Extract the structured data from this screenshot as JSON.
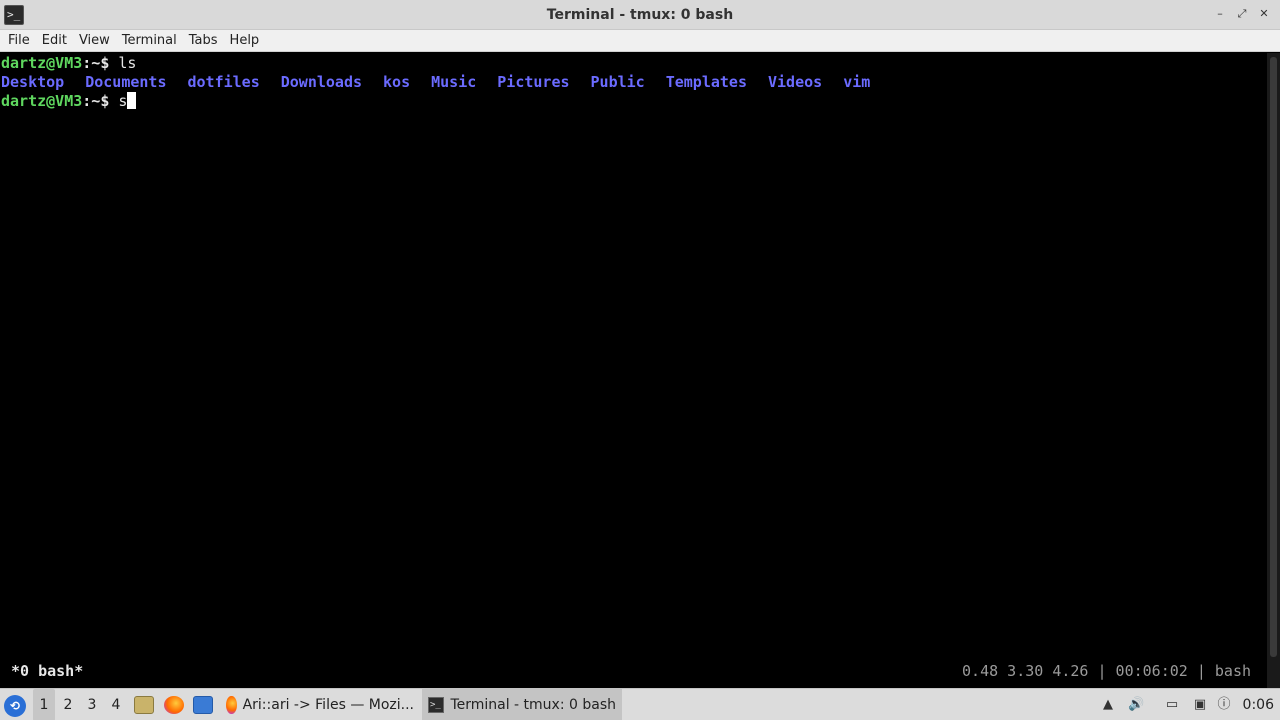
{
  "window": {
    "title": "Terminal - tmux: 0 bash",
    "app_icon_glyph": ">_",
    "buttons": {
      "minimize": "–",
      "maximize": "⤢",
      "close": "✕"
    }
  },
  "menubar": {
    "items": [
      "File",
      "Edit",
      "View",
      "Terminal",
      "Tabs",
      "Help"
    ]
  },
  "terminal": {
    "lines": [
      {
        "user": "dartz@VM3",
        "sep": ":~$",
        "command": "ls"
      },
      {
        "dirs": [
          "Desktop",
          "Documents",
          "dotfiles",
          "Downloads",
          "kos",
          "Music",
          "Pictures",
          "Public",
          "Templates",
          "Videos",
          "vim"
        ]
      },
      {
        "user": "dartz@VM3",
        "sep": ":~$",
        "command": "s"
      }
    ],
    "colors": {
      "prompt": "#5fd75f",
      "directory": "#6b6bff",
      "text": "#e6e6e6"
    }
  },
  "tmux": {
    "left": "*0 bash*",
    "right": "0.48 3.30 4.26 | 00:06:02 | bash"
  },
  "taskbar": {
    "workspaces": [
      "1",
      "2",
      "3",
      "4"
    ],
    "active_workspace": "1",
    "tasks": [
      {
        "label": "Ari::ari -> Files — Mozi...",
        "icon": "firefox-icon"
      },
      {
        "label": "Terminal - tmux: 0 bash",
        "icon": "terminal-icon"
      }
    ],
    "clock": "0:06"
  }
}
